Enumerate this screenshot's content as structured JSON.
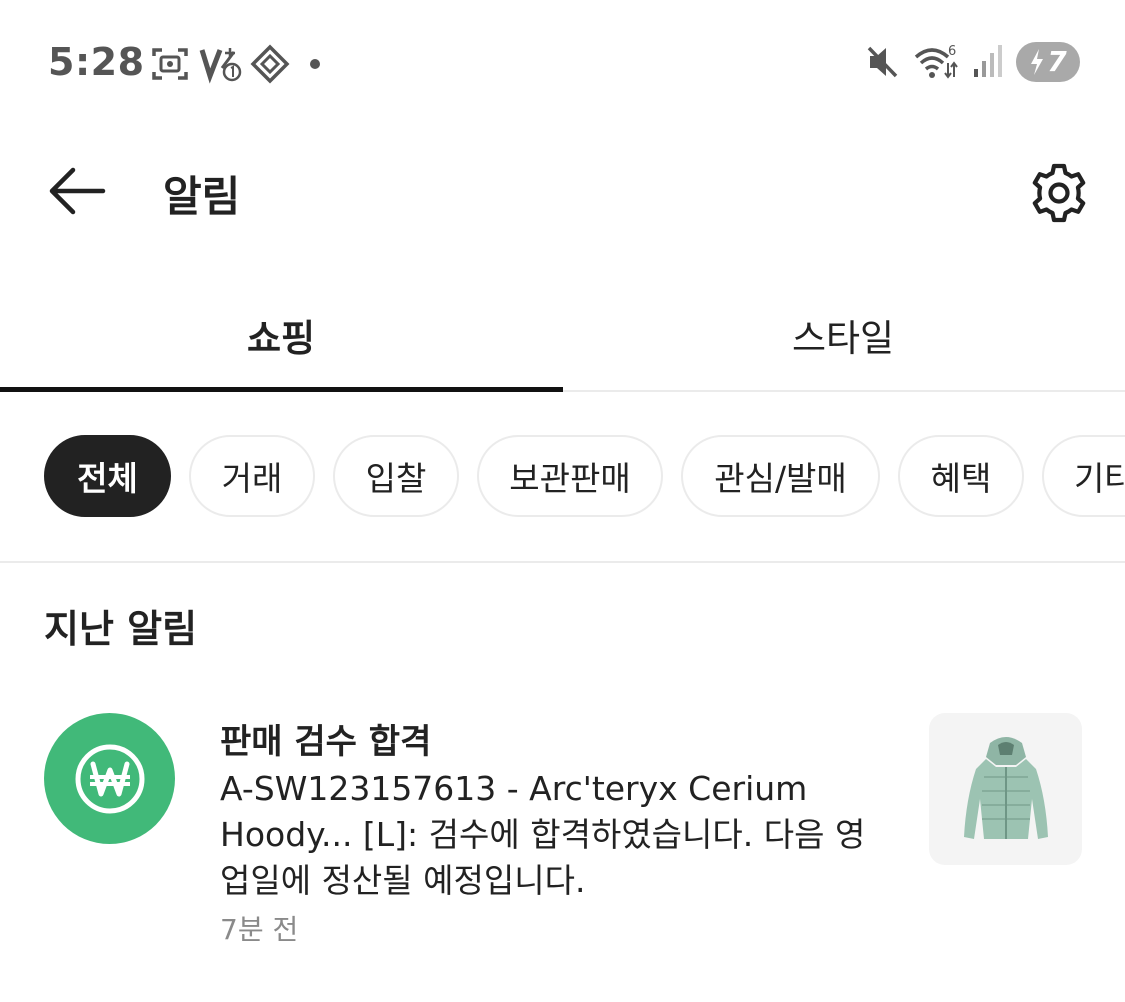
{
  "status_bar": {
    "time": "5:28",
    "battery_level": "7",
    "icons": [
      "screenshot-icon",
      "volte-icon",
      "vpn-key-icon",
      "dot-icon",
      "mute-icon",
      "wifi-6-icon",
      "signal-icon",
      "battery-charging-icon"
    ]
  },
  "header": {
    "title": "알림",
    "back_icon": "arrow-left-icon",
    "settings_icon": "gear-icon"
  },
  "tabs": [
    {
      "label": "쇼핑",
      "active": true
    },
    {
      "label": "스타일",
      "active": false
    }
  ],
  "chips": [
    {
      "label": "전체",
      "active": true
    },
    {
      "label": "거래",
      "active": false
    },
    {
      "label": "입찰",
      "active": false
    },
    {
      "label": "보관판매",
      "active": false
    },
    {
      "label": "관심/발매",
      "active": false
    },
    {
      "label": "혜택",
      "active": false
    },
    {
      "label": "기타",
      "active": false
    }
  ],
  "section": {
    "title": "지난 알림"
  },
  "notifications": [
    {
      "icon": "won-icon",
      "icon_color": "#41b979",
      "title": "판매 검수 합격",
      "body": "A-SW123157613 - Arc'teryx Cerium Hoody... [L]: 검수에 합격하였습니다. 다음 영업일에 정산될 예정입니다.",
      "time": "7분 전",
      "thumbnail": "jacket-thumbnail"
    }
  ],
  "colors": {
    "accent_green": "#41b979",
    "active_chip": "#222222",
    "divider": "#ebebeb"
  }
}
